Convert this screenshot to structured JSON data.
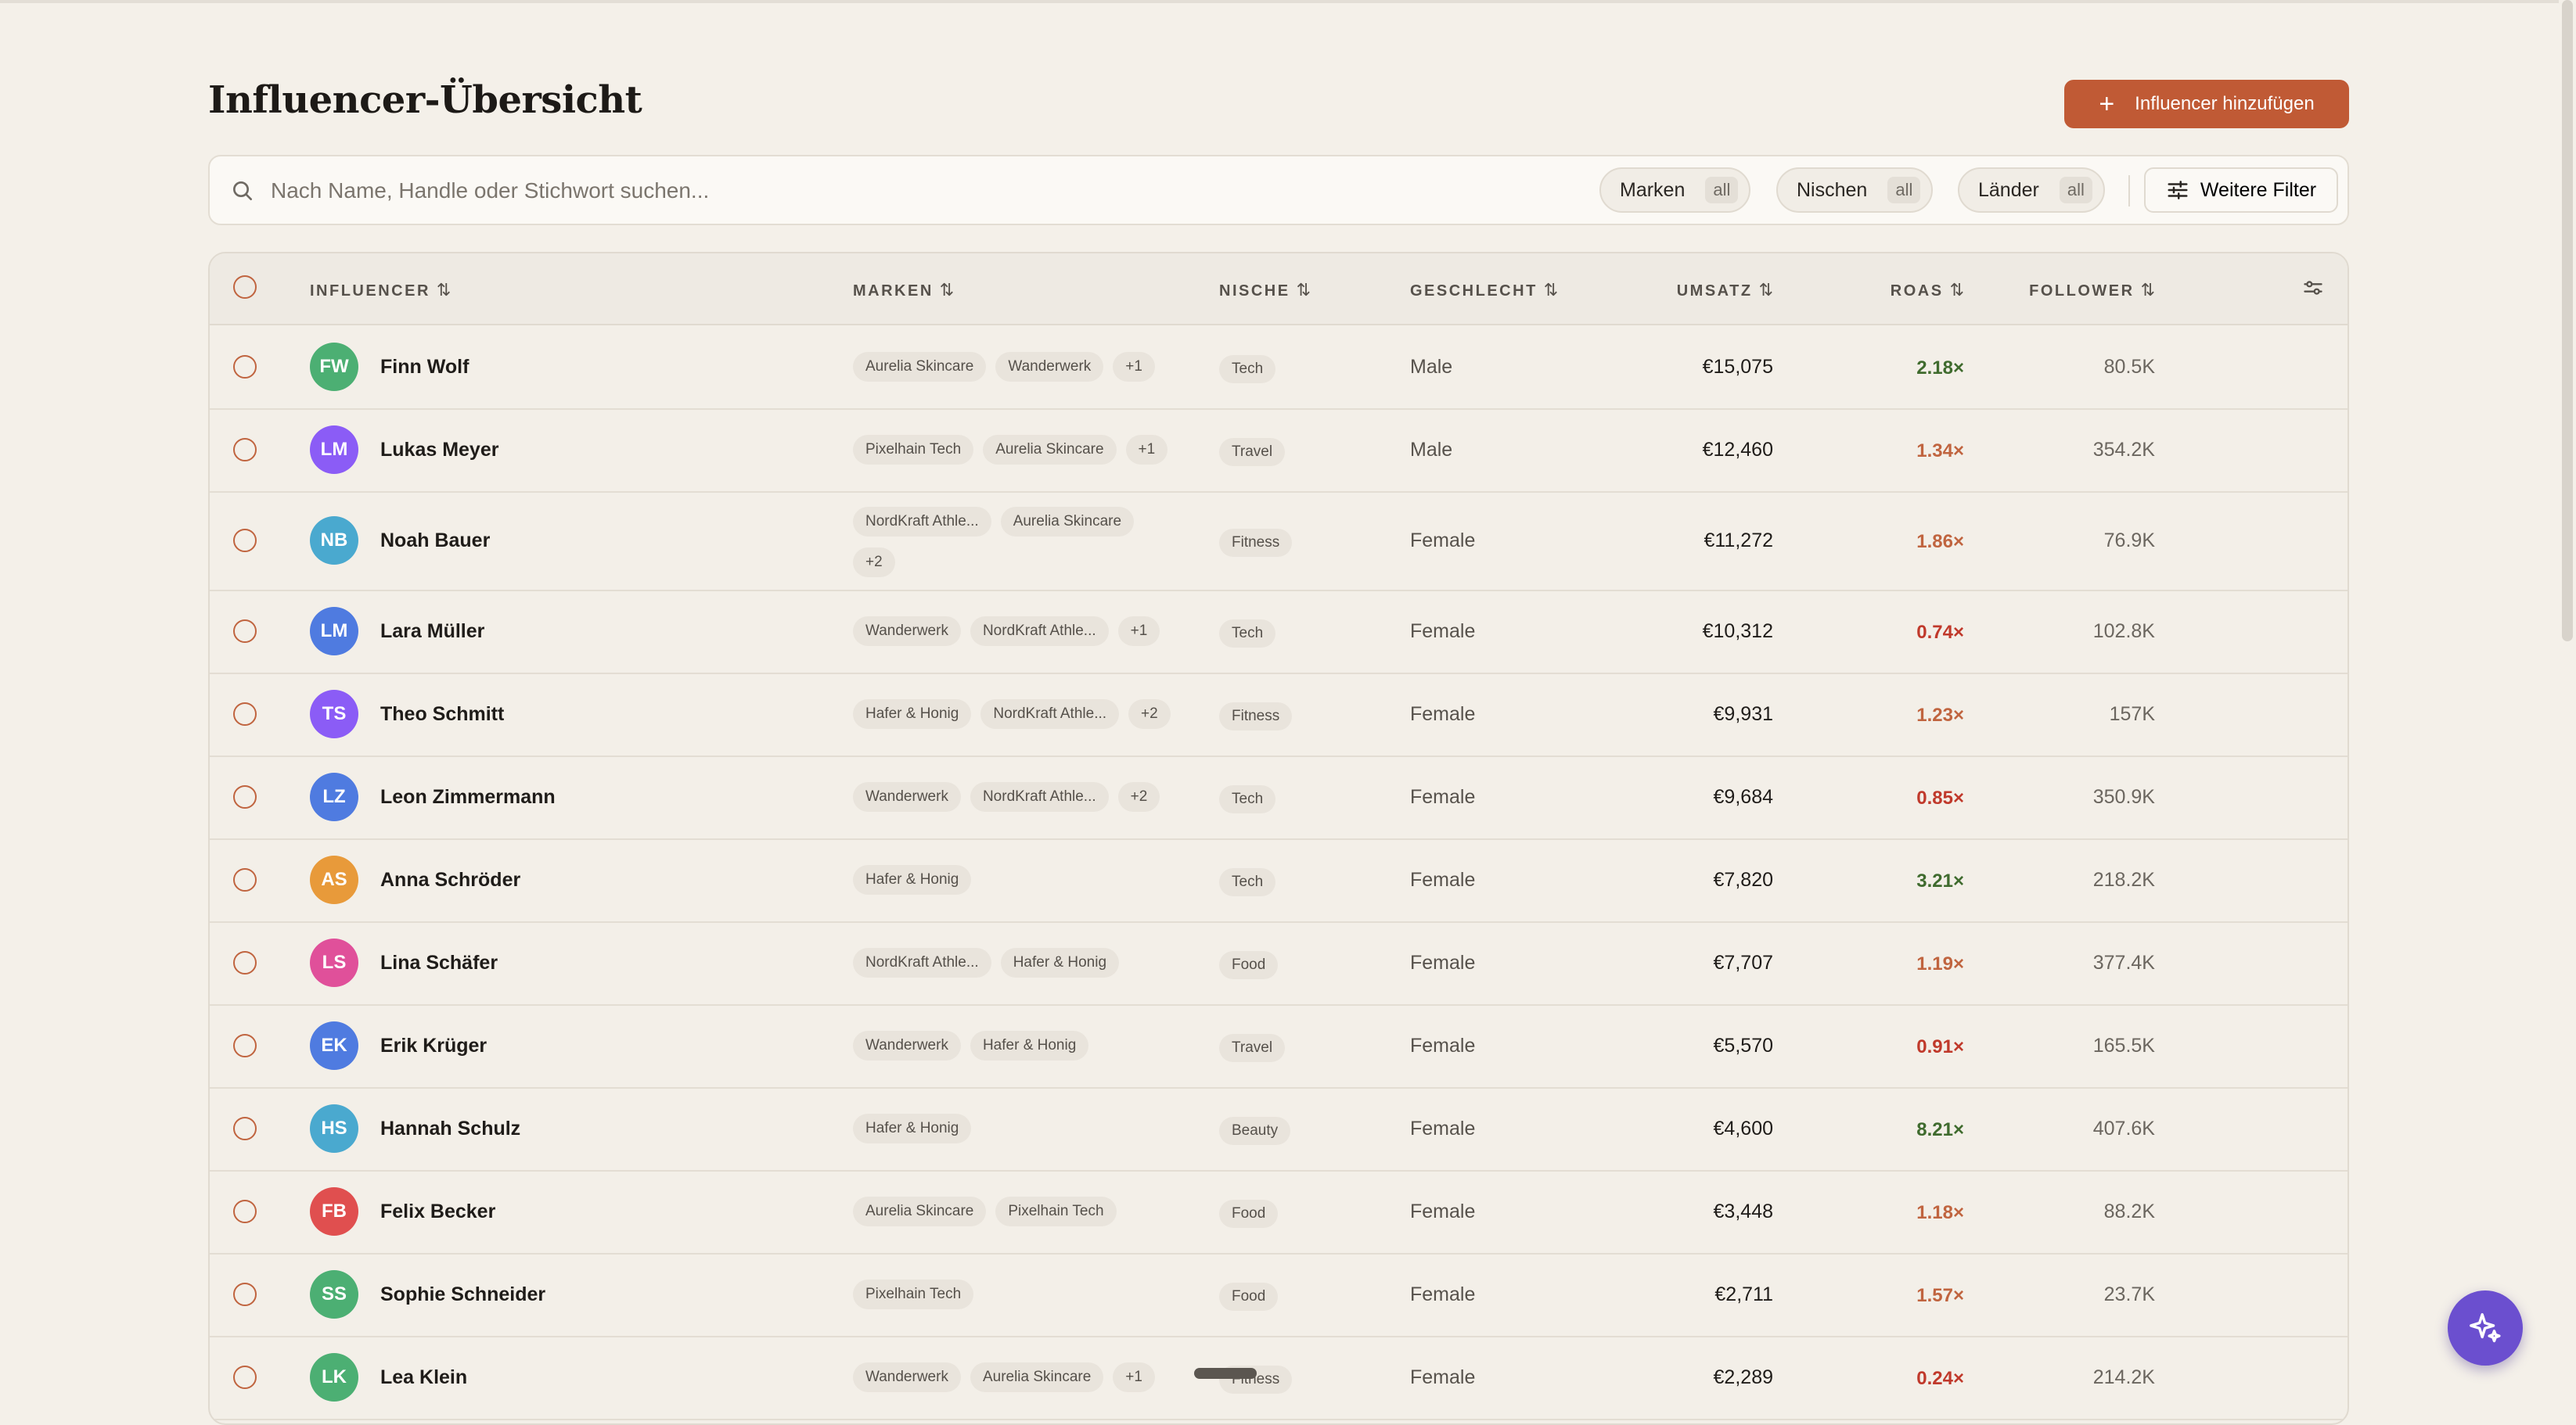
{
  "header": {
    "title": "Influencer-Übersicht",
    "add_button_label": "Influencer hinzufügen"
  },
  "search": {
    "placeholder": "Nach Name, Handle oder Stichwort suchen...",
    "value": ""
  },
  "filters": [
    {
      "label": "Marken",
      "badge": "all"
    },
    {
      "label": "Nischen",
      "badge": "all"
    },
    {
      "label": "Länder",
      "badge": "all"
    }
  ],
  "more_filters_label": "Weitere Filter",
  "table": {
    "columns": [
      "INFLUENCER",
      "MARKEN",
      "NISCHE",
      "GESCHLECHT",
      "UMSATZ",
      "ROAS",
      "FOLLOWER"
    ],
    "rows": [
      {
        "initials": "FW",
        "color": "#4caf73",
        "name": "Finn Wolf",
        "brands": [
          "Aurelia Skincare",
          "Wanderwerk",
          "+1"
        ],
        "niche": "Tech",
        "gender": "Male",
        "revenue": "€15,075",
        "roas": "2.18×",
        "roas_color": "#3f6b2e",
        "followers": "80.5K"
      },
      {
        "initials": "LM",
        "color": "#8b5cf6",
        "name": "Lukas Meyer",
        "brands": [
          "Pixelhain Tech",
          "Aurelia Skincare",
          "+1"
        ],
        "niche": "Travel",
        "gender": "Male",
        "revenue": "€12,460",
        "roas": "1.34×",
        "roas_color": "#c0643f",
        "followers": "354.2K"
      },
      {
        "initials": "NB",
        "color": "#4aa9cf",
        "name": "Noah Bauer",
        "brands": [
          "NordKraft Athle...",
          "Aurelia Skincare",
          "+2"
        ],
        "niche": "Fitness",
        "gender": "Female",
        "revenue": "€11,272",
        "roas": "1.86×",
        "roas_color": "#c0643f",
        "followers": "76.9K"
      },
      {
        "initials": "LM",
        "color": "#4f7be0",
        "name": "Lara Müller",
        "brands": [
          "Wanderwerk",
          "NordKraft Athle...",
          "+1"
        ],
        "niche": "Tech",
        "gender": "Female",
        "revenue": "€10,312",
        "roas": "0.74×",
        "roas_color": "#c0392b",
        "followers": "102.8K"
      },
      {
        "initials": "TS",
        "color": "#8b5cf6",
        "name": "Theo Schmitt",
        "brands": [
          "Hafer & Honig",
          "NordKraft Athle...",
          "+2"
        ],
        "niche": "Fitness",
        "gender": "Female",
        "revenue": "€9,931",
        "roas": "1.23×",
        "roas_color": "#c0643f",
        "followers": "157K"
      },
      {
        "initials": "LZ",
        "color": "#4f7be0",
        "name": "Leon Zimmermann",
        "brands": [
          "Wanderwerk",
          "NordKraft Athle...",
          "+2"
        ],
        "niche": "Tech",
        "gender": "Female",
        "revenue": "€9,684",
        "roas": "0.85×",
        "roas_color": "#c0392b",
        "followers": "350.9K"
      },
      {
        "initials": "AS",
        "color": "#e89a3a",
        "name": "Anna Schröder",
        "brands": [
          "Hafer & Honig"
        ],
        "niche": "Tech",
        "gender": "Female",
        "revenue": "€7,820",
        "roas": "3.21×",
        "roas_color": "#3f6b2e",
        "followers": "218.2K"
      },
      {
        "initials": "LS",
        "color": "#e0509a",
        "name": "Lina Schäfer",
        "brands": [
          "NordKraft Athle...",
          "Hafer & Honig"
        ],
        "niche": "Food",
        "gender": "Female",
        "revenue": "€7,707",
        "roas": "1.19×",
        "roas_color": "#c0643f",
        "followers": "377.4K"
      },
      {
        "initials": "EK",
        "color": "#4f7be0",
        "name": "Erik Krüger",
        "brands": [
          "Wanderwerk",
          "Hafer & Honig"
        ],
        "niche": "Travel",
        "gender": "Female",
        "revenue": "€5,570",
        "roas": "0.91×",
        "roas_color": "#c0392b",
        "followers": "165.5K"
      },
      {
        "initials": "HS",
        "color": "#4aa9cf",
        "name": "Hannah Schulz",
        "brands": [
          "Hafer & Honig"
        ],
        "niche": "Beauty",
        "gender": "Female",
        "revenue": "€4,600",
        "roas": "8.21×",
        "roas_color": "#3f6b2e",
        "followers": "407.6K"
      },
      {
        "initials": "FB",
        "color": "#e04f4f",
        "name": "Felix Becker",
        "brands": [
          "Aurelia Skincare",
          "Pixelhain Tech"
        ],
        "niche": "Food",
        "gender": "Female",
        "revenue": "€3,448",
        "roas": "1.18×",
        "roas_color": "#c0643f",
        "followers": "88.2K"
      },
      {
        "initials": "SS",
        "color": "#4caf73",
        "name": "Sophie Schneider",
        "brands": [
          "Pixelhain Tech"
        ],
        "niche": "Food",
        "gender": "Female",
        "revenue": "€2,711",
        "roas": "1.57×",
        "roas_color": "#c0643f",
        "followers": "23.7K"
      },
      {
        "initials": "LK",
        "color": "#4caf73",
        "name": "Lea Klein",
        "brands": [
          "Wanderwerk",
          "Aurelia Skincare",
          "+1"
        ],
        "niche": "Fitness",
        "gender": "Female",
        "revenue": "€2,289",
        "roas": "0.24×",
        "roas_color": "#c0392b",
        "followers": "214.2K"
      }
    ]
  },
  "colors": {
    "accent": "#c05a35",
    "background": "#f4f0e9",
    "fab": "#6b4fcf"
  }
}
